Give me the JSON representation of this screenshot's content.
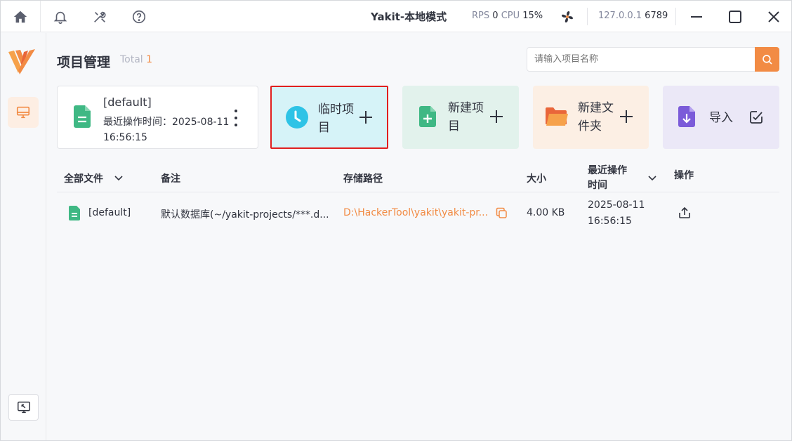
{
  "titlebar": {
    "title": "Yakit-本地模式",
    "rps_label": "RPS",
    "rps_value": "0",
    "cpu_label": "CPU",
    "cpu_value": "15%",
    "host": "127.0.0.1",
    "port": "6789"
  },
  "header": {
    "title": "项目管理",
    "total_label": "Total",
    "total_count": "1"
  },
  "search": {
    "placeholder": "请输入项目名称"
  },
  "current_project": {
    "name": "[default]",
    "time_label": "最近操作时间：2025-08-11 16:56:15"
  },
  "actions": {
    "temp_project": "临时项目",
    "new_project": "新建项目",
    "new_folder": "新建文件夹",
    "import": "导入"
  },
  "table": {
    "columns": {
      "files": "全部文件",
      "note": "备注",
      "path": "存储路径",
      "size": "大小",
      "time": "最近操作时间",
      "action": "操作"
    },
    "rows": [
      {
        "name": "[default]",
        "note": "默认数据库(~/yakit-projects/***.d...",
        "path": "D:\\HackerTool\\yakit\\yakit-pr...",
        "size": "4.00 KB",
        "date": "2025-08-11",
        "time": "16:56:15"
      }
    ]
  },
  "colors": {
    "accent": "#f28b44",
    "temp_card": "#d6f3f8",
    "new_card": "#e2f2ec",
    "folder_card": "#fcefe4",
    "import_card": "#ebe8f7",
    "highlight_border": "#e01f1f"
  }
}
